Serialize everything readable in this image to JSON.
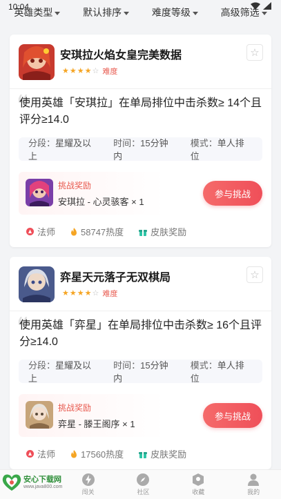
{
  "status": {
    "time": "10:04"
  },
  "filters": [
    {
      "label": "英雄类型"
    },
    {
      "label": "默认排序"
    },
    {
      "label": "难度等级"
    },
    {
      "label": "高级筛选"
    }
  ],
  "cards": [
    {
      "title": "安琪拉火焰女皇完美数据",
      "difficulty_rating": 4,
      "difficulty_max": 5,
      "difficulty_label": "难度",
      "description": "使用英雄「安琪拉」在单局排位中击杀数≥ 14个且评分≥14.0",
      "info": {
        "rank_label": "分段：",
        "rank_value": "星耀及以上",
        "time_label": "时间：",
        "time_value": "15分钟内",
        "mode_label": "模式：",
        "mode_value": "单人排位"
      },
      "reward": {
        "title": "挑战奖励",
        "item": "安琪拉 - 心灵骇客 × 1"
      },
      "join_label": "参与挑战",
      "meta": {
        "role": "法师",
        "heat": "58747热度",
        "reward_type": "皮肤奖励"
      },
      "colors": {
        "avatar_bg": "#c83a2e",
        "reward_bg": "#7a3fa8"
      }
    },
    {
      "title": "弈星天元落子无双棋局",
      "difficulty_rating": 4,
      "difficulty_max": 5,
      "difficulty_label": "难度",
      "description": "使用英雄「弈星」在单局排位中击杀数≥ 16个且评分≥14.0",
      "info": {
        "rank_label": "分段：",
        "rank_value": "星耀及以上",
        "time_label": "时间：",
        "time_value": "15分钟内",
        "mode_label": "模式：",
        "mode_value": "单人排位"
      },
      "reward": {
        "title": "挑战奖励",
        "item": "弈星 - 滕王阁序 × 1"
      },
      "join_label": "参与挑战",
      "meta": {
        "role": "法师",
        "heat": "17560热度",
        "reward_type": "皮肤奖励"
      },
      "colors": {
        "avatar_bg": "#4a5a8c",
        "reward_bg": "#c7a57a"
      }
    }
  ],
  "nav": [
    {
      "label": "闯关",
      "icon": "bolt-icon"
    },
    {
      "label": "社区",
      "icon": "compass-icon"
    },
    {
      "label": "收藏",
      "icon": "bookmark-icon"
    },
    {
      "label": "我的",
      "icon": "user-icon"
    }
  ],
  "watermark": {
    "main": "安心下载网",
    "sub": "www.java800.com"
  },
  "theme": {
    "accent": "#ef4f59",
    "star": "#f5a524",
    "text": "#222222"
  }
}
